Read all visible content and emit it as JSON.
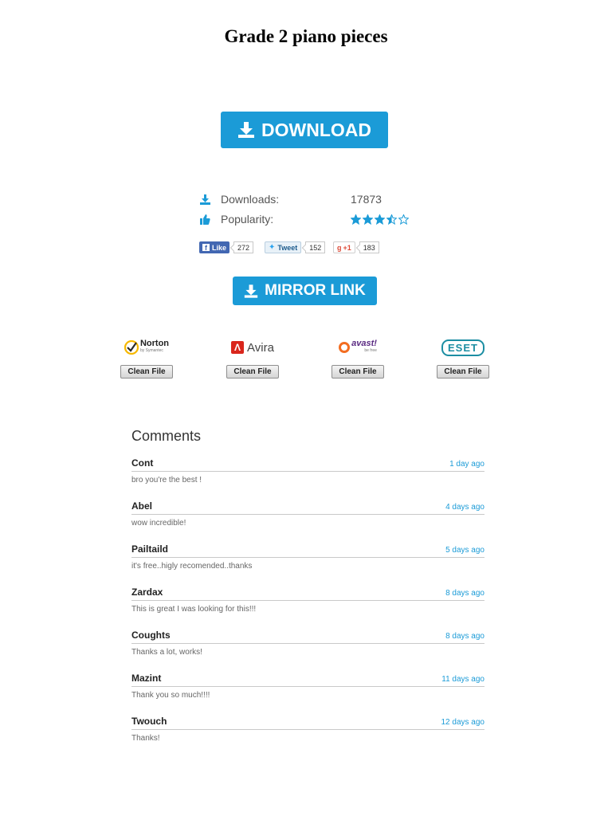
{
  "title": "Grade 2 piano pieces",
  "download_button": {
    "label": "DOWNLOAD"
  },
  "stats": {
    "downloads_label": "Downloads:",
    "downloads_value": "17873",
    "popularity_label": "Popularity:",
    "rating": 3.5,
    "rating_max": 5
  },
  "share": {
    "facebook": {
      "label": "Like",
      "count": "272"
    },
    "twitter": {
      "label": "Tweet",
      "count": "152"
    },
    "google": {
      "label": "+1",
      "count": "183"
    }
  },
  "mirror_button": {
    "label": "MIRROR LINK"
  },
  "antivirus": [
    {
      "name": "Norton",
      "sub": "by Symantec",
      "badge": "Clean File",
      "color": "#f6b800"
    },
    {
      "name": "Avira",
      "badge": "Clean File",
      "color": "#d9261c"
    },
    {
      "name": "avast!",
      "sub": "be free",
      "badge": "Clean File",
      "color": "#f36d21"
    },
    {
      "name": "eset",
      "badge": "Clean File",
      "color": "#1c8ea3"
    }
  ],
  "comments_title": "Comments",
  "comments": [
    {
      "author": "Cont",
      "time": "1 day ago",
      "text": "bro you're the best !"
    },
    {
      "author": "Abel",
      "time": "4 days ago",
      "text": "wow incredible!"
    },
    {
      "author": "Pailtaild",
      "time": "5 days ago",
      "text": "it's free..higly recomended..thanks"
    },
    {
      "author": "Zardax",
      "time": "8 days ago",
      "text": "This is great I was looking for this!!!"
    },
    {
      "author": "Coughts",
      "time": "8 days ago",
      "text": "Thanks a lot, works!"
    },
    {
      "author": "Mazint",
      "time": "11 days ago",
      "text": "Thank you so much!!!!"
    },
    {
      "author": "Twouch",
      "time": "12 days ago",
      "text": "Thanks!"
    }
  ],
  "colors": {
    "accent": "#1b9bd7",
    "star": "#1b9bd7"
  }
}
